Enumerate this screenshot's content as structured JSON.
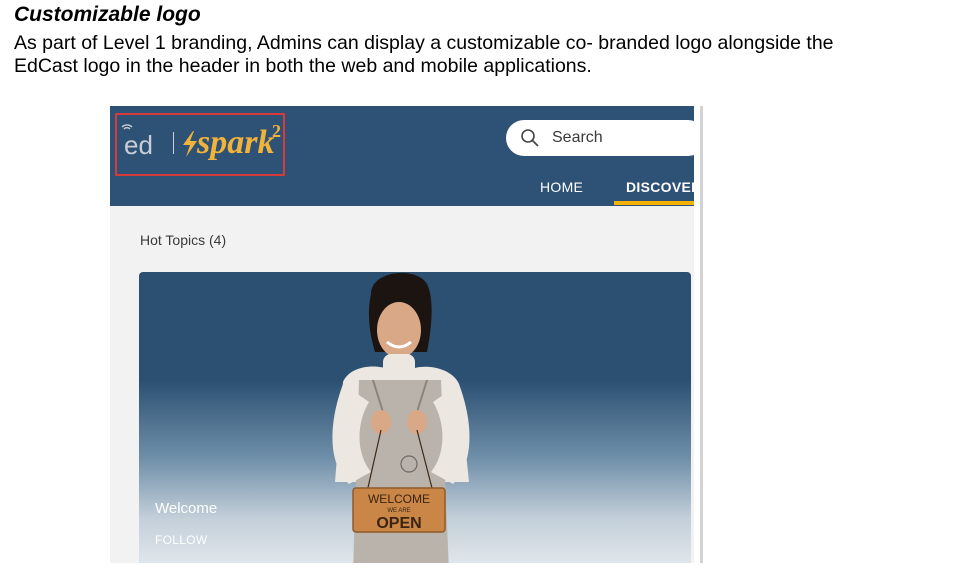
{
  "document": {
    "title": "Customizable logo",
    "body_lines": [
      "As part of Level 1 branding, Admins can display a customizable co- branded logo alongside the",
      "EdCast logo in the header in both the web and mobile applications."
    ]
  },
  "screenshot": {
    "header": {
      "logo_left_text": "ed",
      "logo_brand_text": "spark",
      "logo_brand_superscript": "2",
      "search_placeholder": "Search",
      "nav": {
        "home_label": "HOME",
        "discover_label": "DISCOVER"
      }
    },
    "section_title": "Hot Topics (4)",
    "card": {
      "title": "Welcome",
      "follow_label": "FOLLOW",
      "sign_line1": "WELCOME",
      "sign_line2": "WE ARE",
      "sign_line3": "OPEN"
    }
  },
  "colors": {
    "header_bg": "#2e5276",
    "accent_underline": "#f5b200",
    "logo_highlight_border": "#d63a3a",
    "brand_logo_gold": "#f1b33a"
  },
  "icons": [
    "wifi-signal-icon",
    "lightning-bolt-icon",
    "search-icon"
  ]
}
